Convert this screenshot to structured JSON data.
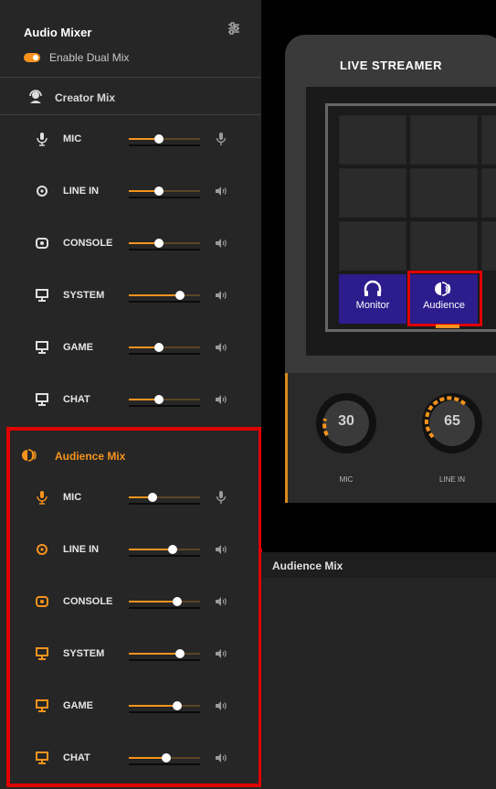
{
  "mixer": {
    "title": "Audio Mixer",
    "settings_icon": "mixer-settings-icon",
    "dual_mix": {
      "label": "Enable Dual Mix",
      "enabled": true
    },
    "creator": {
      "title": "Creator Mix",
      "channels": [
        {
          "label": "MIC",
          "level": 0.42,
          "icon": "mic-icon",
          "end_icon": "mic-mute-icon"
        },
        {
          "label": "LINE IN",
          "level": 0.42,
          "icon": "line-in-icon",
          "end_icon": "speaker-icon"
        },
        {
          "label": "CONSOLE",
          "level": 0.42,
          "icon": "console-icon",
          "end_icon": "speaker-icon"
        },
        {
          "label": "SYSTEM",
          "level": 0.72,
          "icon": "monitor-icon",
          "end_icon": "speaker-icon"
        },
        {
          "label": "GAME",
          "level": 0.42,
          "icon": "monitor-icon",
          "end_icon": "speaker-icon"
        },
        {
          "label": "CHAT",
          "level": 0.42,
          "icon": "monitor-icon",
          "end_icon": "speaker-icon"
        }
      ]
    },
    "audience": {
      "title": "Audience Mix",
      "channels": [
        {
          "label": "MIC",
          "level": 0.33,
          "icon": "mic-icon",
          "end_icon": "mic-mute-icon"
        },
        {
          "label": "LINE IN",
          "level": 0.62,
          "icon": "line-in-icon",
          "end_icon": "speaker-icon"
        },
        {
          "label": "CONSOLE",
          "level": 0.68,
          "icon": "console-icon",
          "end_icon": "speaker-icon"
        },
        {
          "label": "SYSTEM",
          "level": 0.72,
          "icon": "monitor-icon",
          "end_icon": "speaker-icon"
        },
        {
          "label": "GAME",
          "level": 0.68,
          "icon": "monitor-icon",
          "end_icon": "speaker-icon"
        },
        {
          "label": "CHAT",
          "level": 0.52,
          "icon": "monitor-icon",
          "end_icon": "speaker-icon"
        }
      ]
    }
  },
  "device": {
    "name": "LIVE STREAMER",
    "buttons": [
      {
        "label": "Monitor",
        "icon": "headphones-icon"
      },
      {
        "label": "Audience",
        "icon": "audience-icon"
      }
    ],
    "knobs": [
      {
        "value": "30",
        "label": "MIC"
      },
      {
        "value": "65",
        "label": "LINE IN"
      }
    ]
  },
  "lower_panel": {
    "title": "Audience Mix"
  },
  "colors": {
    "accent": "#f7931d",
    "highlight": "#e00000",
    "pad_button": "#2c1c8c"
  }
}
